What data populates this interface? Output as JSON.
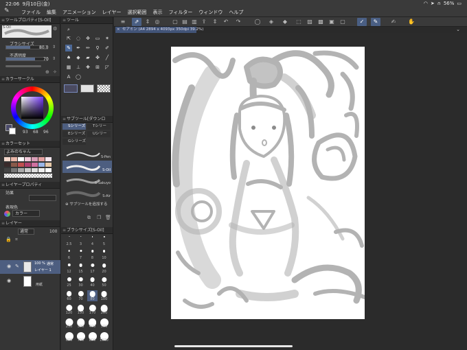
{
  "status": {
    "time": "22:06",
    "date": "9月10日(金)",
    "battery": "56%"
  },
  "menu": [
    "ファイル",
    "編集",
    "アニメーション",
    "レイヤー",
    "選択範囲",
    "表示",
    "フィルター",
    "ウィンドウ",
    "ヘルプ"
  ],
  "document_tab": {
    "close": "×",
    "title": "セアミン (A4 2894 x 4093px 350dpi 39.2%)"
  },
  "tool_property": {
    "title": "ツールプロパティ[S-Oil]",
    "brush_name": "S-Oil",
    "brush_size_label": "ブラシサイズ",
    "brush_size_value": "80.0",
    "opacity_label": "不透明度",
    "opacity_value": "70"
  },
  "color_circle": {
    "title": "カラーサークル",
    "h": "93",
    "s": "68",
    "v": "96"
  },
  "color_set": {
    "title": "カラーセット",
    "set_name": "よみのちゃん"
  },
  "layer_property": {
    "title": "レイヤープロパティ",
    "effect_label": "効果",
    "expression_label": "表現色",
    "expression_value": "カラー"
  },
  "layer_panel": {
    "title": "レイヤー",
    "blend_mode": "通常",
    "opacity": "100",
    "layers": [
      {
        "opacity": "100 %",
        "blend": "通常",
        "name": "レイヤー 1"
      },
      {
        "name": "用紙"
      }
    ]
  },
  "tool_panel": {
    "title": "ツール"
  },
  "subtool": {
    "title": "サブツール[ダウンロ",
    "groups": [
      "Sシリーズ",
      "Tシリー",
      "Eシリーズ",
      "Uシリー",
      "Gシリーズ"
    ],
    "brushes": [
      "S-Pen",
      "S-Oil",
      "S-Sakuyo",
      "S-Air"
    ],
    "add_label": "サブツールを追加する"
  },
  "brush_size_panel": {
    "title": "ブラシサイズ[S-Oil]",
    "sizes": [
      "2.5",
      "3",
      "4",
      "5",
      "6",
      "7",
      "8",
      "10",
      "12",
      "15",
      "17",
      "20",
      "25",
      "30",
      "40",
      "50",
      "60",
      "70",
      "80",
      "100",
      "120",
      "150",
      "170",
      "200",
      "250",
      "300",
      "400",
      "500",
      "600",
      "700",
      "800",
      "1000"
    ]
  }
}
